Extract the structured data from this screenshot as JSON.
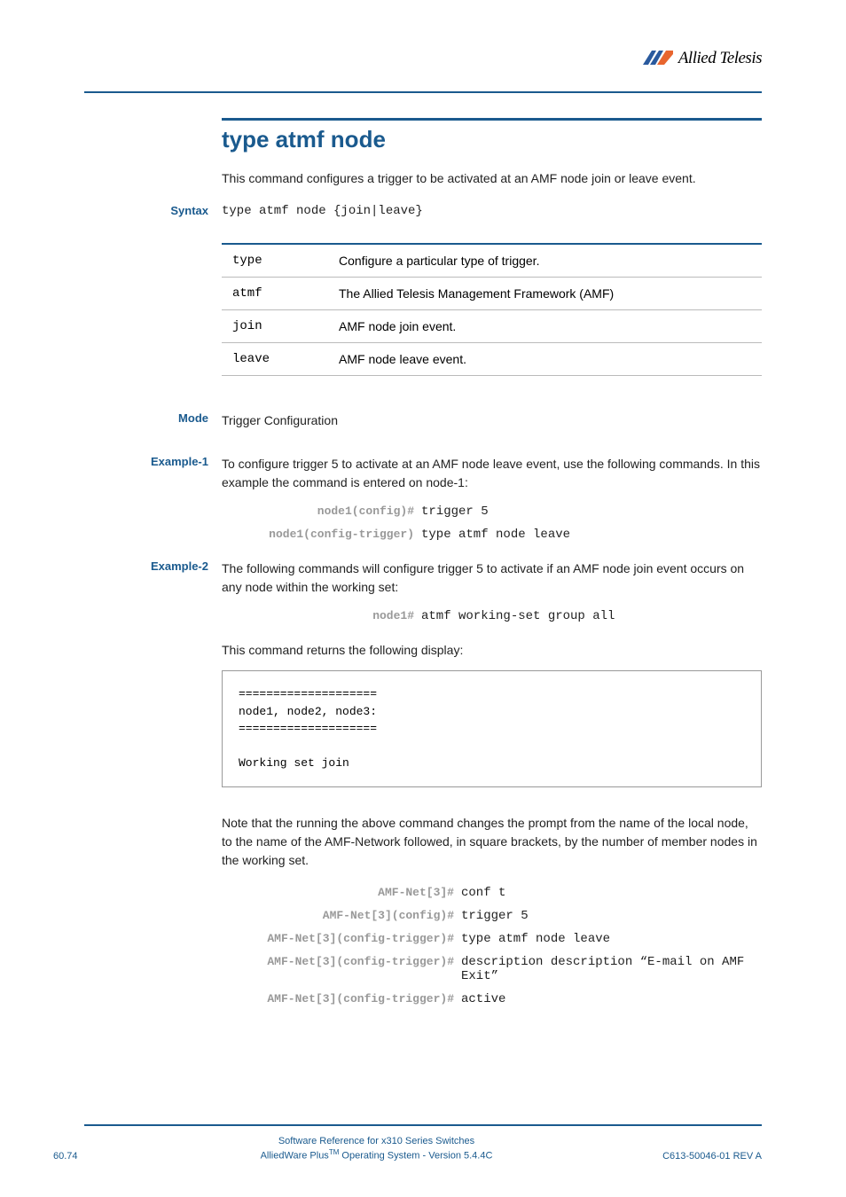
{
  "header": {
    "logo_text": "Allied Telesis"
  },
  "title": "type atmf node",
  "intro": "This command configures a trigger to be activated at an AMF node join or leave event.",
  "syntax": {
    "label": "Syntax",
    "code": "type atmf node {join|leave}"
  },
  "params": [
    {
      "name": "type",
      "desc": "Configure a particular type of trigger."
    },
    {
      "name": "atmf",
      "desc": "The Allied Telesis Management Framework (AMF)"
    },
    {
      "name": "join",
      "desc": "AMF node join event."
    },
    {
      "name": "leave",
      "desc": "AMF node leave event."
    }
  ],
  "mode": {
    "label": "Mode",
    "text": "Trigger Configuration"
  },
  "example1": {
    "label": "Example-1",
    "text": "To configure trigger 5 to activate at an AMF node leave event, use the following commands. In this example the command is entered on node-1:",
    "cmds": [
      {
        "prompt": "node1(config)#",
        "text": "trigger 5"
      },
      {
        "prompt": "node1(config-trigger)",
        "text": "type atmf node leave"
      }
    ]
  },
  "example2": {
    "label": "Example-2",
    "text": "The following commands will configure trigger 5 to activate if an AMF node join event occurs on any node within the working set:",
    "cmds": [
      {
        "prompt": "node1#",
        "text": "atmf working-set group all"
      }
    ],
    "follow_text": "This command returns the following display:",
    "output": "====================\nnode1, node2, node3:\n====================\n\nWorking set join",
    "note": "Note that the running the above command changes the prompt from the name of the local node, to the name of the AMF-Network followed, in square brackets, by the number of member nodes in the working set.",
    "cmds2": [
      {
        "prompt": "AMF-Net[3]#",
        "text": "conf t"
      },
      {
        "prompt": "AMF-Net[3](config)#",
        "text": "trigger 5"
      },
      {
        "prompt": "AMF-Net[3](config-trigger)#",
        "text": "type atmf node leave"
      },
      {
        "prompt": "AMF-Net[3](config-trigger)#",
        "text": "description description “E-mail on AMF Exit”"
      },
      {
        "prompt": "AMF-Net[3](config-trigger)#",
        "text": "active"
      }
    ]
  },
  "footer": {
    "left": "60.74",
    "center1": "Software Reference for x310 Series Switches",
    "center2a": "AlliedWare Plus",
    "center2b": " Operating System  - Version 5.4.4C",
    "right": "C613-50046-01 REV A"
  }
}
